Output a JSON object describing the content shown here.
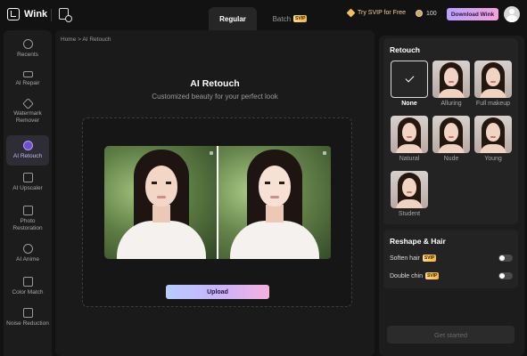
{
  "header": {
    "logo_text": "Wink",
    "tabs": [
      {
        "label": "Regular",
        "active": true
      },
      {
        "label": "Batch",
        "badge": "SVIP"
      }
    ],
    "try_svip": "Try SVIP for Free",
    "coins": "100",
    "download_label": "Download Wink"
  },
  "sidebar": {
    "items": [
      {
        "label": "Recents",
        "icon": "clock-icon"
      },
      {
        "label": "AI Repair",
        "icon": "repair-icon"
      },
      {
        "label": "Watermark Remover",
        "icon": "eraser-icon"
      },
      {
        "label": "AI Retouch",
        "icon": "retouch-icon",
        "active": true
      },
      {
        "label": "AI Upscaler",
        "icon": "4k-icon"
      },
      {
        "label": "Photo Restoration",
        "icon": "photo-icon"
      },
      {
        "label": "AI Anime",
        "icon": "anime-icon"
      },
      {
        "label": "Color Match",
        "icon": "color-match-icon"
      },
      {
        "label": "Noise Reduction",
        "icon": "noise-icon"
      }
    ]
  },
  "main": {
    "breadcrumb": "Home > AI Retouch",
    "title": "AI Retouch",
    "subtitle": "Customized beauty for your perfect look",
    "upload_label": "Upload"
  },
  "retouch_panel": {
    "title": "Retouch",
    "styles": [
      {
        "label": "None",
        "selected": true
      },
      {
        "label": "Alluring"
      },
      {
        "label": "Full makeup"
      },
      {
        "label": "Natural"
      },
      {
        "label": "Nude"
      },
      {
        "label": "Young"
      },
      {
        "label": "Student"
      }
    ]
  },
  "reshape_panel": {
    "title": "Reshape & Hair",
    "options": [
      {
        "label": "Soften hair",
        "badge": "SVIP",
        "enabled": false
      },
      {
        "label": "Double chin",
        "badge": "SVIP",
        "enabled": false
      }
    ]
  },
  "get_started_label": "Get started",
  "colors": {
    "accent_gradient_start": "#b7ccff",
    "accent_gradient_end": "#f5b1df",
    "svip_gold": "#f0c15b",
    "active_nav": "#c9b8ff"
  }
}
